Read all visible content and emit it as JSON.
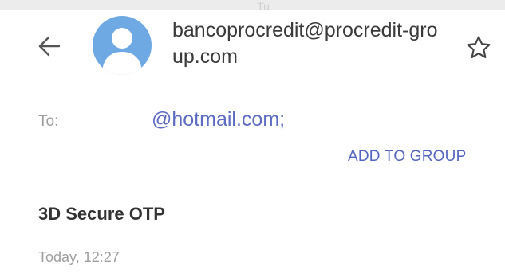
{
  "header": {
    "topmark": "Tu",
    "sender_email": "bancoprocredit@procredit-group.com"
  },
  "recipients": {
    "to_label": "To:",
    "to_address": "@hotmail.com;",
    "add_to_group_label": "ADD TO GROUP"
  },
  "message": {
    "subject": "3D Secure OTP",
    "date": "Today, 12:27"
  },
  "icons": {
    "back": "back-arrow-icon",
    "avatar": "default-avatar-icon",
    "star": "star-outline-icon"
  },
  "colors": {
    "accent": "#5566c0",
    "avatar_bg": "#6fa9e3",
    "secondary_text": "#9e9e9e"
  }
}
